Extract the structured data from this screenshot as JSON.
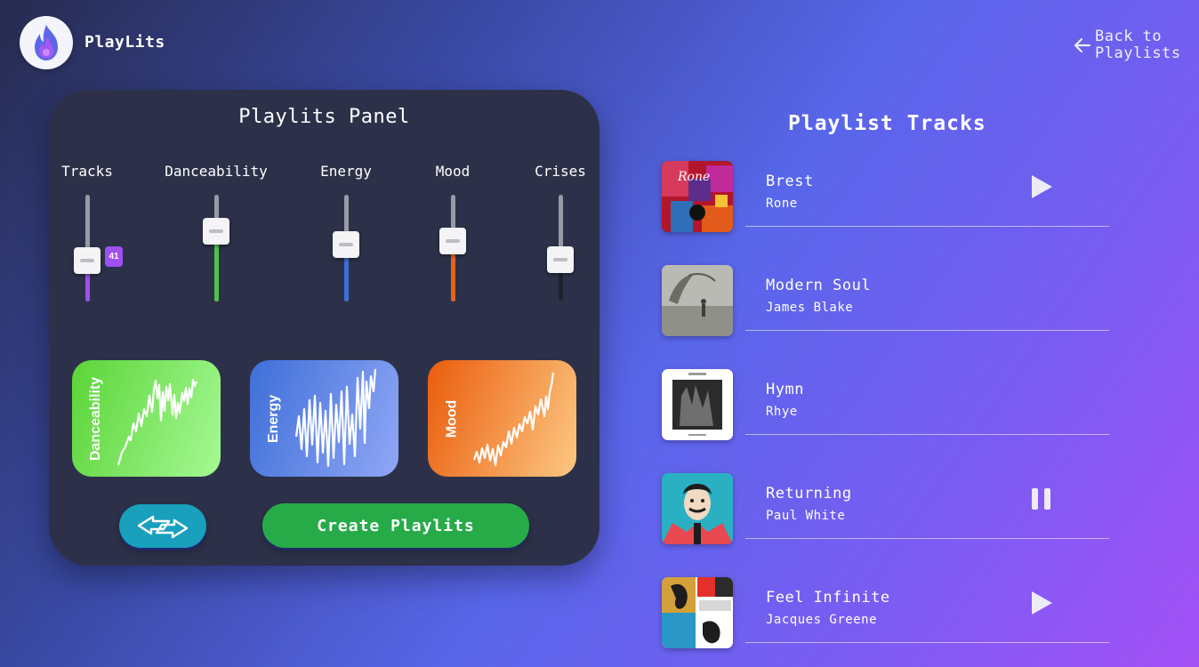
{
  "app": {
    "name": "PlayLits"
  },
  "nav": {
    "back_label": "Back to Playlists"
  },
  "panel": {
    "title": "Playlits Panel",
    "sliders": [
      {
        "label": "Tracks",
        "value": 0.38,
        "color": "#a04ff0",
        "badge": "41"
      },
      {
        "label": "Danceability",
        "value": 0.66,
        "color": "#4cc54a"
      },
      {
        "label": "Energy",
        "value": 0.53,
        "color": "#3d6fd8"
      },
      {
        "label": "Mood",
        "value": 0.57,
        "color": "#e8621c"
      },
      {
        "label": "Crises",
        "value": 0.39,
        "color": "#20232c"
      }
    ],
    "cards": [
      {
        "label": "Danceability",
        "icon": "danceability-waveform-icon",
        "gradient": [
          "#5bd438",
          "#a5f994"
        ]
      },
      {
        "label": "Energy",
        "icon": "energy-waveform-icon",
        "gradient": [
          "#3e6fd8",
          "#90a7f6"
        ]
      },
      {
        "label": "Mood",
        "icon": "mood-waveform-icon",
        "gradient": [
          "#ea5c0c",
          "#fdc883"
        ]
      }
    ],
    "shuffle_icon": "shuffle-arrows-icon",
    "create_label": "Create Playlits"
  },
  "playlist": {
    "title": "Playlist Tracks",
    "tracks": [
      {
        "name": "Brest",
        "artist": "Rone",
        "state": "play"
      },
      {
        "name": "Modern Soul",
        "artist": "James Blake",
        "state": "none"
      },
      {
        "name": "Hymn",
        "artist": "Rhye",
        "state": "none"
      },
      {
        "name": "Returning",
        "artist": "Paul White",
        "state": "pause"
      },
      {
        "name": "Feel Infinite",
        "artist": "Jacques Greene",
        "state": "play"
      }
    ]
  }
}
